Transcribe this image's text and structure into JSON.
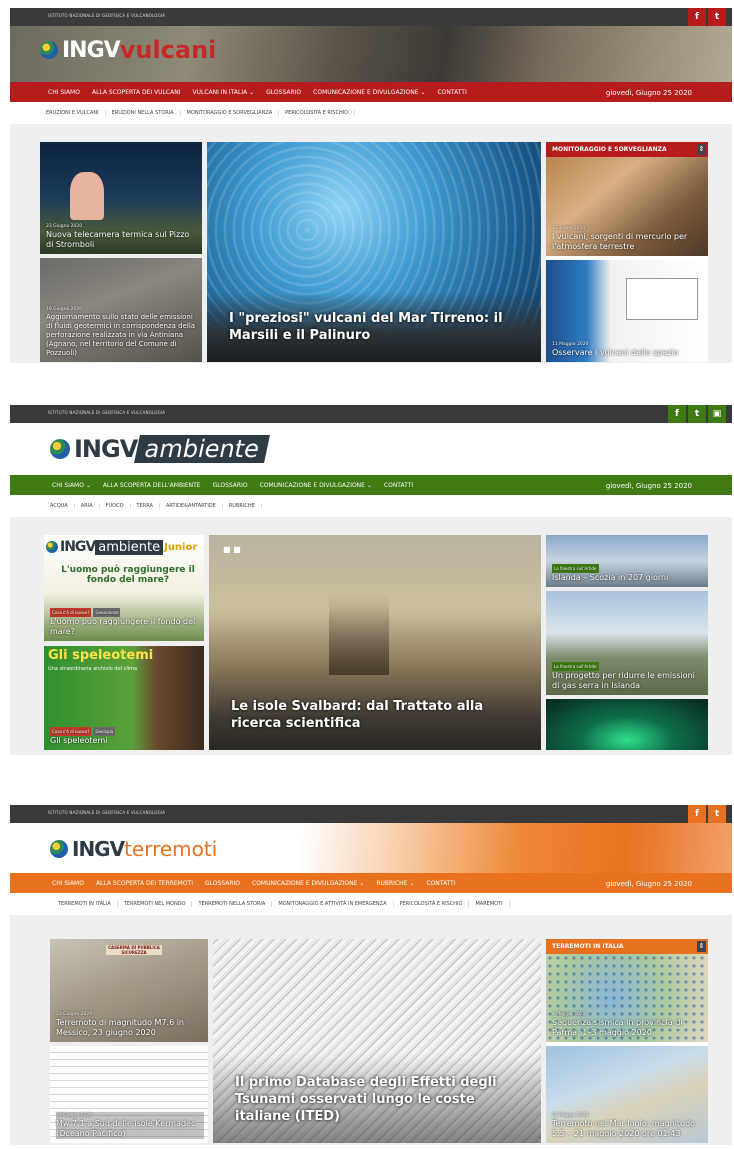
{
  "colors": {
    "vulcani_red": "#b71c1c",
    "ambiente_green": "#3f7a12",
    "terremoti_orange": "#e8711f",
    "dark_bar": "#3a3a3a"
  },
  "vulcani": {
    "institute": "ISTITUTO NAZIONALE DI GEOFISICA E VULCANOLOGIA",
    "social": [
      "f",
      "t"
    ],
    "logo_ingv": "INGV",
    "logo_word": "vulcani",
    "nav": [
      "CHI SIAMO",
      "ALLA SCOPERTA DEI VULCANI",
      "VULCANI IN ITALIA ⌄",
      "GLOSSARIO",
      "COMUNICAZIONE E DIVULGAZIONE ⌄",
      "CONTATTI"
    ],
    "date": "giovedì, Giugno 25 2020",
    "subnav": [
      "ERUZIONI E VULCANI",
      "ERUZIONI NELLA STORIA",
      "MONITORAGGIO E SORVEGLIANZA",
      "PERICOLOSITÀ E RISCHIO"
    ],
    "left1": {
      "date": "23 Giugno 2020",
      "title": "Nuova telecamera termica sul Pizzo di Stromboli"
    },
    "left2": {
      "date": "16 Giugno 2020",
      "title": "Aggiornamento sullo stato delle emissioni di fluidi geotermici in corrispondenza della perforazione realizzata in via Antiniana (Agnano, nel territorio del Comune di Pozzuoli)"
    },
    "main": {
      "title": "I \"preziosi\" vulcani del Mar Tirreno: il Marsili e il Palinuro"
    },
    "section": "MONITORAGGIO E SORVEGLIANZA",
    "right1": {
      "date": "1 Giugno 2020",
      "title": "I vulcani, sorgenti di mercurio per l'atmosfera terrestre"
    },
    "right2": {
      "date": "11 Maggio 2020",
      "title": "Osservare i vulcani dallo spazio"
    }
  },
  "ambiente": {
    "institute": "ISTITUTO NAZIONALE DI GEOFISICA E VULCANOLOGIA",
    "social": [
      "f",
      "t",
      "▣"
    ],
    "logo_ingv": "INGV",
    "logo_word": "ambiente",
    "nav": [
      "CHI SIAMO ⌄",
      "ALLA SCOPERTA DELL'AMBIENTE",
      "GLOSSARIO",
      "COMUNICAZIONE E DIVULGAZIONE ⌄",
      "CONTATTI"
    ],
    "date": "giovedì, Giugno 25 2020",
    "subnav": [
      "ACQUA",
      "ARIA",
      "FUOCO",
      "TERRA",
      "ARTIDE&ANTARTIDE",
      "RUBRICHE"
    ],
    "left1": {
      "logo_ingv": "INGV",
      "logo_word": "ambiente",
      "junior": "Junior",
      "headline": "L'uomo può raggiungere il fondo del mare?",
      "tag": "Cosa c'è di nuovo?",
      "tag2": "Geoscienze",
      "title": "L'uomo può raggiungere il fondo del mare?"
    },
    "left2": {
      "headline": "Gli speleotemi",
      "sub": "Una straordinaria archivio del clima",
      "tag": "Cosa c'è di nuovo?",
      "tag2": "Geologia",
      "title": "Gli speleotemi"
    },
    "main": {
      "title": "Le isole Svalbard: dal Trattato alla ricerca scientifica"
    },
    "right1": {
      "tag": "La finestra sull'Artide",
      "title": "Islanda – Scozia in 207 giorni"
    },
    "right2": {
      "tag": "La finestra sull'Artide",
      "title": "Un progetto per ridurre le emissioni di gas serra in Islanda"
    }
  },
  "terremoti": {
    "institute": "ISTITUTO NAZIONALE DI GEOFISICA E VULCANOLOGIA",
    "social": [
      "f",
      "t"
    ],
    "logo_ingv": "INGV",
    "logo_word": "terremoti",
    "nav": [
      "CHI SIAMO",
      "ALLA SCOPERTA DEI TERREMOTI",
      "GLOSSARIO",
      "COMUNICAZIONE E DIVULGAZIONE ⌄",
      "RUBRICHE ⌄",
      "CONTATTI"
    ],
    "date": "giovedì, Giugno 25 2020",
    "subnav": [
      "TERREMOTI IN ITALIA",
      "TERREMOTI NEL MONDO",
      "TERREMOTI NELLA STORIA",
      "MONITORAGGIO E ATTIVITÀ IN EMERGENZA",
      "PERICOLOSITÀ E RISCHIO",
      "MAREMOTI"
    ],
    "left1": {
      "sign": "CASERMA DI PUBBLICA SICUREZZA",
      "date": "23 Giugno 2020",
      "title": "Terremoto di magnitudo M7.6 in Messico, 23 giugno 2020"
    },
    "left2": {
      "date": "18 Giugno 2020",
      "title": "Mw 7.1 a Sud delle isole Kermadec (Oceano Pacifico)"
    },
    "main": {
      "title": "Il primo Database degli Effetti degli Tsunami osservati lungo le coste italiane (ITED)"
    },
    "section": "TERREMOTI IN ITALIA",
    "right1": {
      "date": "4 Maggio 2020",
      "title": "Sequenza sismica in provincia di Parma, 1–3 maggio 2020"
    },
    "right2": {
      "date": "22 Maggio 2020",
      "title": "Terremoto nel Mar Ionio, magnitudo 5.5 – 21 maggio 2020 ore 01:43"
    }
  }
}
